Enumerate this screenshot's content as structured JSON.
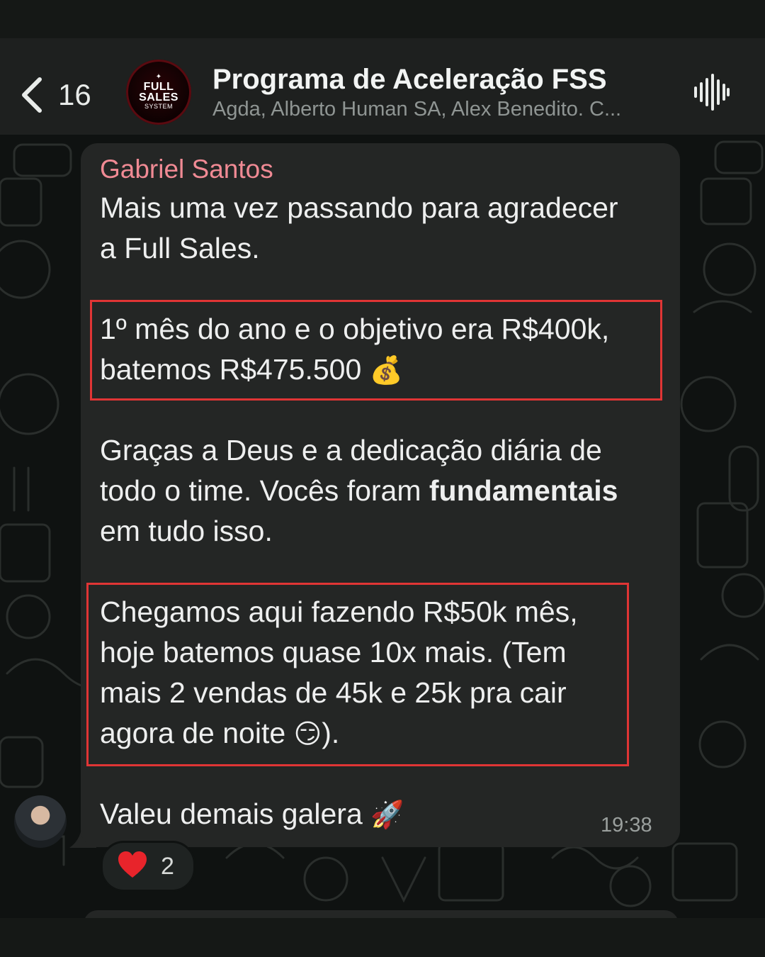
{
  "header": {
    "back_count": "16",
    "group_title": "Programa de Aceleração FSS",
    "group_members": "Agda, Alberto Human SA, Alex Benedito. C...",
    "group_logo": {
      "line1": "FULL",
      "line2": "SALES",
      "line3": "SYSTEM"
    },
    "call_icon": "audio-wave-icon"
  },
  "message": {
    "sender": "Gabriel Santos",
    "lines": {
      "l1": "Mais uma vez passando para agradecer",
      "l2": "a Full Sales.",
      "l3": "1º mês do ano e o objetivo era R$400k,",
      "l4": "batemos R$475.500",
      "l5": "Graças a Deus e a dedicação diária de",
      "l6_a": "todo o time. Vocês foram ",
      "l6_b": "fundamentais",
      "l7": "em tudo isso.",
      "l8": "Chegamos aqui fazendo R$50k mês,",
      "l9": "hoje batemos quase 10x mais. (Tem",
      "l10": "mais 2 vendas de 45k e 25k pra cair",
      "l11_a": "agora de noite",
      "l11_b": ").",
      "l12": "Valeu demais galera"
    },
    "emoji_money": "💰",
    "emoji_smirk": "😏",
    "emoji_rocket": "🚀",
    "time": "19:38",
    "highlight_color": "#e03535"
  },
  "reaction": {
    "emoji": "heart",
    "count": "2"
  },
  "colors": {
    "sender": "#f08a94",
    "bubble": "#242625",
    "header": "#1e201f"
  }
}
